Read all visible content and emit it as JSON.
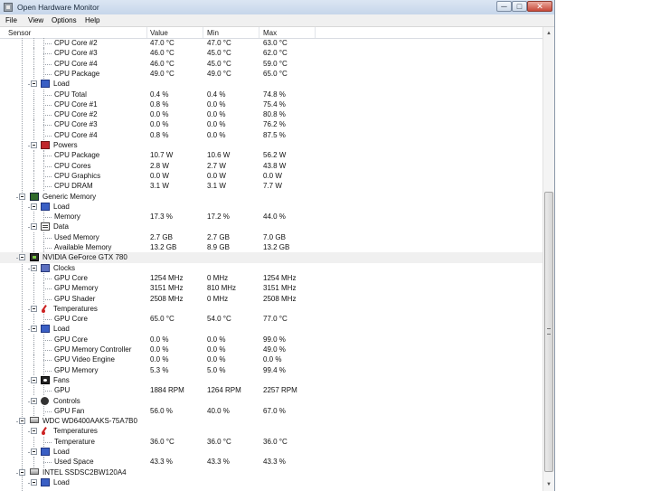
{
  "window": {
    "title": "Open Hardware Monitor",
    "min_glyph": "─",
    "max_glyph": "□",
    "close_glyph": "✕"
  },
  "menu": {
    "file": "File",
    "view": "View",
    "options": "Options",
    "help": "Help"
  },
  "columns": {
    "sensor": "Sensor",
    "value": "Value",
    "min": "Min",
    "max": "Max"
  },
  "scrollbar": {
    "up": "▲",
    "down": "▼"
  },
  "rows": [
    {
      "label": "CPU Core #2",
      "value": "47.0 °C",
      "min": "47.0 °C",
      "max": "63.0 °C"
    },
    {
      "label": "CPU Core #3",
      "value": "46.0 °C",
      "min": "45.0 °C",
      "max": "62.0 °C"
    },
    {
      "label": "CPU Core #4",
      "value": "46.0 °C",
      "min": "45.0 °C",
      "max": "59.0 °C"
    },
    {
      "label": "CPU Package",
      "value": "49.0 °C",
      "min": "49.0 °C",
      "max": "65.0 °C"
    },
    {
      "label": "Load",
      "value": "",
      "min": "",
      "max": ""
    },
    {
      "label": "CPU Total",
      "value": "0.4 %",
      "min": "0.4 %",
      "max": "74.8 %"
    },
    {
      "label": "CPU Core #1",
      "value": "0.8 %",
      "min": "0.0 %",
      "max": "75.4 %"
    },
    {
      "label": "CPU Core #2",
      "value": "0.0 %",
      "min": "0.0 %",
      "max": "80.8 %"
    },
    {
      "label": "CPU Core #3",
      "value": "0.0 %",
      "min": "0.0 %",
      "max": "76.2 %"
    },
    {
      "label": "CPU Core #4",
      "value": "0.8 %",
      "min": "0.0 %",
      "max": "87.5 %"
    },
    {
      "label": "Powers",
      "value": "",
      "min": "",
      "max": ""
    },
    {
      "label": "CPU Package",
      "value": "10.7 W",
      "min": "10.6 W",
      "max": "56.2 W"
    },
    {
      "label": "CPU Cores",
      "value": "2.8 W",
      "min": "2.7 W",
      "max": "43.8 W"
    },
    {
      "label": "CPU Graphics",
      "value": "0.0 W",
      "min": "0.0 W",
      "max": "0.0 W"
    },
    {
      "label": "CPU DRAM",
      "value": "3.1 W",
      "min": "3.1 W",
      "max": "7.7 W"
    },
    {
      "label": "Generic Memory",
      "value": "",
      "min": "",
      "max": ""
    },
    {
      "label": "Load",
      "value": "",
      "min": "",
      "max": ""
    },
    {
      "label": "Memory",
      "value": "17.3 %",
      "min": "17.2 %",
      "max": "44.0 %"
    },
    {
      "label": "Data",
      "value": "",
      "min": "",
      "max": ""
    },
    {
      "label": "Used Memory",
      "value": "2.7 GB",
      "min": "2.7 GB",
      "max": "7.0 GB"
    },
    {
      "label": "Available Memory",
      "value": "13.2 GB",
      "min": "8.9 GB",
      "max": "13.2 GB"
    },
    {
      "label": "NVIDIA GeForce GTX 780",
      "value": "",
      "min": "",
      "max": ""
    },
    {
      "label": "Clocks",
      "value": "",
      "min": "",
      "max": ""
    },
    {
      "label": "GPU Core",
      "value": "1254 MHz",
      "min": "0 MHz",
      "max": "1254 MHz"
    },
    {
      "label": "GPU Memory",
      "value": "3151 MHz",
      "min": "810 MHz",
      "max": "3151 MHz"
    },
    {
      "label": "GPU Shader",
      "value": "2508 MHz",
      "min": "0 MHz",
      "max": "2508 MHz"
    },
    {
      "label": "Temperatures",
      "value": "",
      "min": "",
      "max": ""
    },
    {
      "label": "GPU Core",
      "value": "65.0 °C",
      "min": "54.0 °C",
      "max": "77.0 °C"
    },
    {
      "label": "Load",
      "value": "",
      "min": "",
      "max": ""
    },
    {
      "label": "GPU Core",
      "value": "0.0 %",
      "min": "0.0 %",
      "max": "99.0 %"
    },
    {
      "label": "GPU Memory Controller",
      "value": "0.0 %",
      "min": "0.0 %",
      "max": "49.0 %"
    },
    {
      "label": "GPU Video Engine",
      "value": "0.0 %",
      "min": "0.0 %",
      "max": "0.0 %"
    },
    {
      "label": "GPU Memory",
      "value": "5.3 %",
      "min": "5.0 %",
      "max": "99.4 %"
    },
    {
      "label": "Fans",
      "value": "",
      "min": "",
      "max": ""
    },
    {
      "label": "GPU",
      "value": "1884 RPM",
      "min": "1264 RPM",
      "max": "2257 RPM"
    },
    {
      "label": "Controls",
      "value": "",
      "min": "",
      "max": ""
    },
    {
      "label": "GPU Fan",
      "value": "56.0 %",
      "min": "40.0 %",
      "max": "67.0 %"
    },
    {
      "label": "WDC WD6400AAKS-75A7B0",
      "value": "",
      "min": "",
      "max": ""
    },
    {
      "label": "Temperatures",
      "value": "",
      "min": "",
      "max": ""
    },
    {
      "label": "Temperature",
      "value": "36.0 °C",
      "min": "36.0 °C",
      "max": "36.0 °C"
    },
    {
      "label": "Load",
      "value": "",
      "min": "",
      "max": ""
    },
    {
      "label": "Used Space",
      "value": "43.3 %",
      "min": "43.3 %",
      "max": "43.3 %"
    },
    {
      "label": "INTEL SSDSC2BW120A4",
      "value": "",
      "min": "",
      "max": ""
    },
    {
      "label": "Load",
      "value": "",
      "min": "",
      "max": ""
    }
  ]
}
